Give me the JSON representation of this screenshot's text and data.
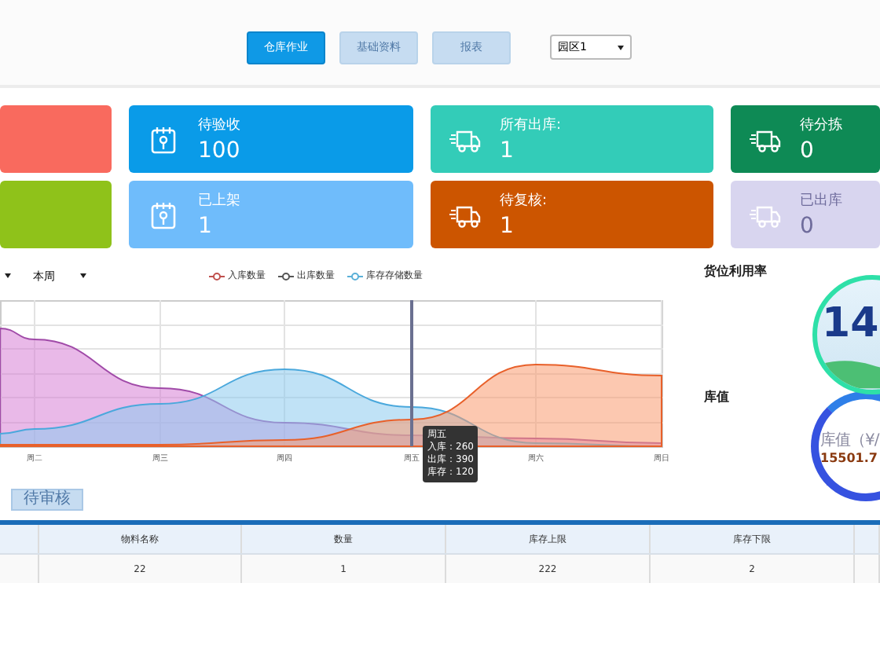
{
  "toolbar": {
    "buttons": [
      {
        "label": "仓库作业",
        "selected": true
      },
      {
        "label": "基础资料",
        "selected": false
      },
      {
        "label": "报表",
        "selected": false
      }
    ],
    "park_select": {
      "value": "园区1"
    }
  },
  "cards": [
    {
      "kind": "blank",
      "color": "#f96a5e"
    },
    {
      "kind": "clipboard",
      "label": "待验收",
      "value": "100",
      "color": "#0a9be8"
    },
    {
      "kind": "truck",
      "label": "所有出库:",
      "value": "1",
      "color": "#33ccb8"
    },
    {
      "kind": "truck",
      "label": "待分拣",
      "value": "0",
      "color": "#0e8a55"
    },
    {
      "kind": "blank",
      "color": "#8fc21a"
    },
    {
      "kind": "clipboard",
      "label": "已上架",
      "value": "1",
      "color": "#6fbcfb"
    },
    {
      "kind": "truck",
      "label": "待复核:",
      "value": "1",
      "color": "#cc5500"
    },
    {
      "kind": "truck",
      "label": "已出库",
      "value": "0",
      "color": "#d8d5ef"
    }
  ],
  "chart_panel": {
    "period_select": {
      "value": "本周"
    },
    "legend": [
      {
        "name": "入库数量",
        "color": "#c0504d"
      },
      {
        "name": "出库数量",
        "color": "#555555"
      },
      {
        "name": "库存存储数量",
        "color": "#5ab0d8"
      }
    ],
    "x_labels": [
      "周二",
      "周三",
      "周四",
      "周五",
      "周六",
      "周日"
    ],
    "tooltip": {
      "title": "周五",
      "lines": [
        "入库：260",
        "出库：390",
        "库存：120"
      ]
    }
  },
  "gauges": {
    "utilization": {
      "title": "货位利用率",
      "value": "14"
    },
    "stock_value": {
      "title": "库值",
      "caption": "库值（¥/",
      "value": "15501.7"
    }
  },
  "table": {
    "action_button": "待审核",
    "columns": [
      "物料名称",
      "数量",
      "库存上限",
      "库存下限"
    ],
    "rows": [
      [
        "22",
        "1",
        "222",
        "2"
      ]
    ]
  }
}
